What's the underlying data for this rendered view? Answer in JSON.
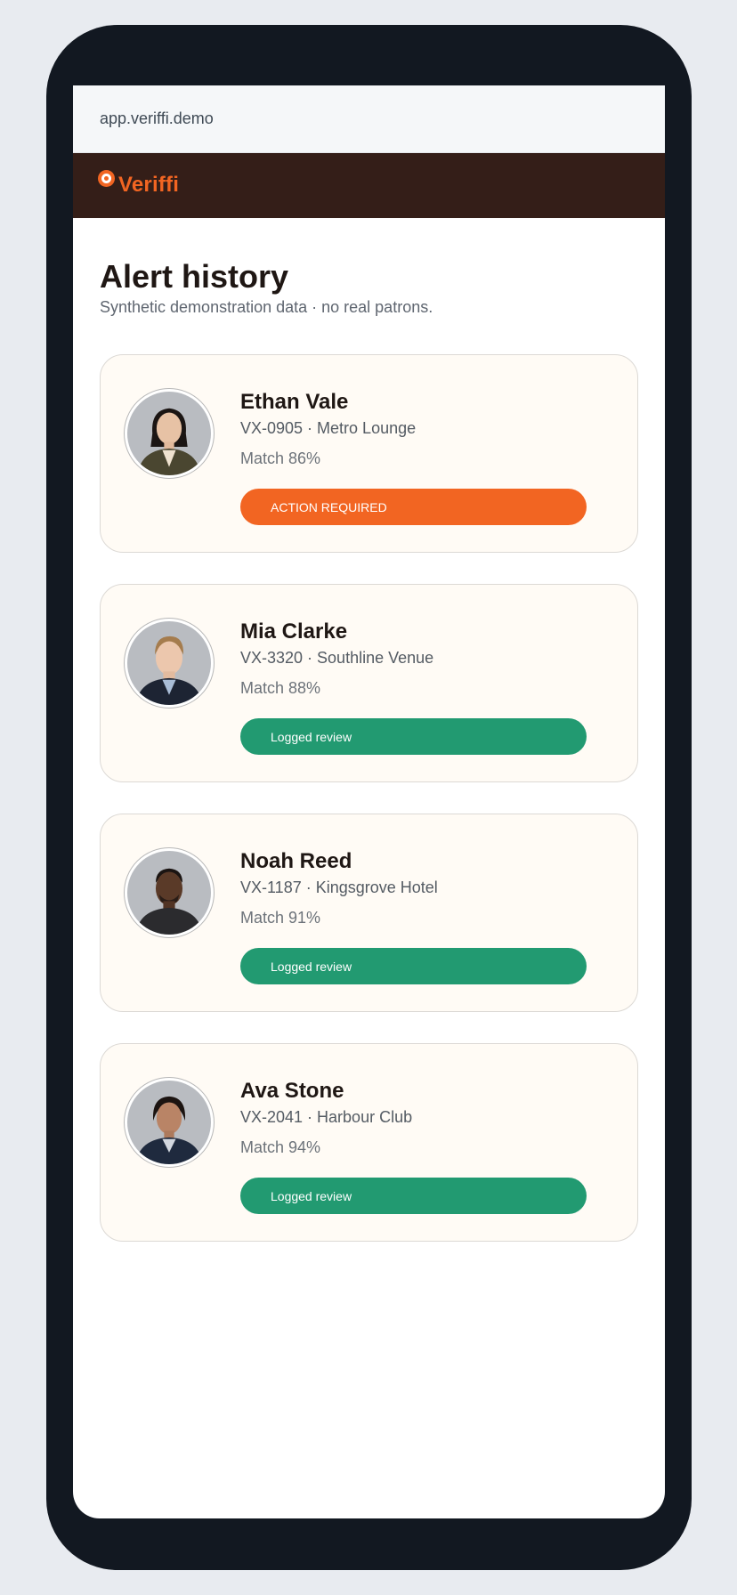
{
  "browser": {
    "url": "app.veriffi.demo"
  },
  "header": {
    "brand": "Veriffi"
  },
  "page": {
    "title": "Alert history",
    "subtitle": "Synthetic demonstration data · no real patrons."
  },
  "colors": {
    "brand": "#f26522",
    "header_bg": "#341e18",
    "action_required": "#f26522",
    "logged_review": "#229a71",
    "card_bg": "#fffbf5"
  },
  "alerts": [
    {
      "name": "Ethan Vale",
      "meta": "VX-0905 · Metro Lounge",
      "match": "Match 86%",
      "status": "ACTION REQUIRED",
      "status_kind": "alert"
    },
    {
      "name": "Mia Clarke",
      "meta": "VX-3320 · Southline Venue",
      "match": "Match 88%",
      "status": "Logged review",
      "status_kind": "ok"
    },
    {
      "name": "Noah Reed",
      "meta": "VX-1187 · Kingsgrove Hotel",
      "match": "Match 91%",
      "status": "Logged review",
      "status_kind": "ok"
    },
    {
      "name": "Ava Stone",
      "meta": "VX-2041 · Harbour Club",
      "match": "Match 94%",
      "status": "Logged review",
      "status_kind": "ok"
    }
  ]
}
